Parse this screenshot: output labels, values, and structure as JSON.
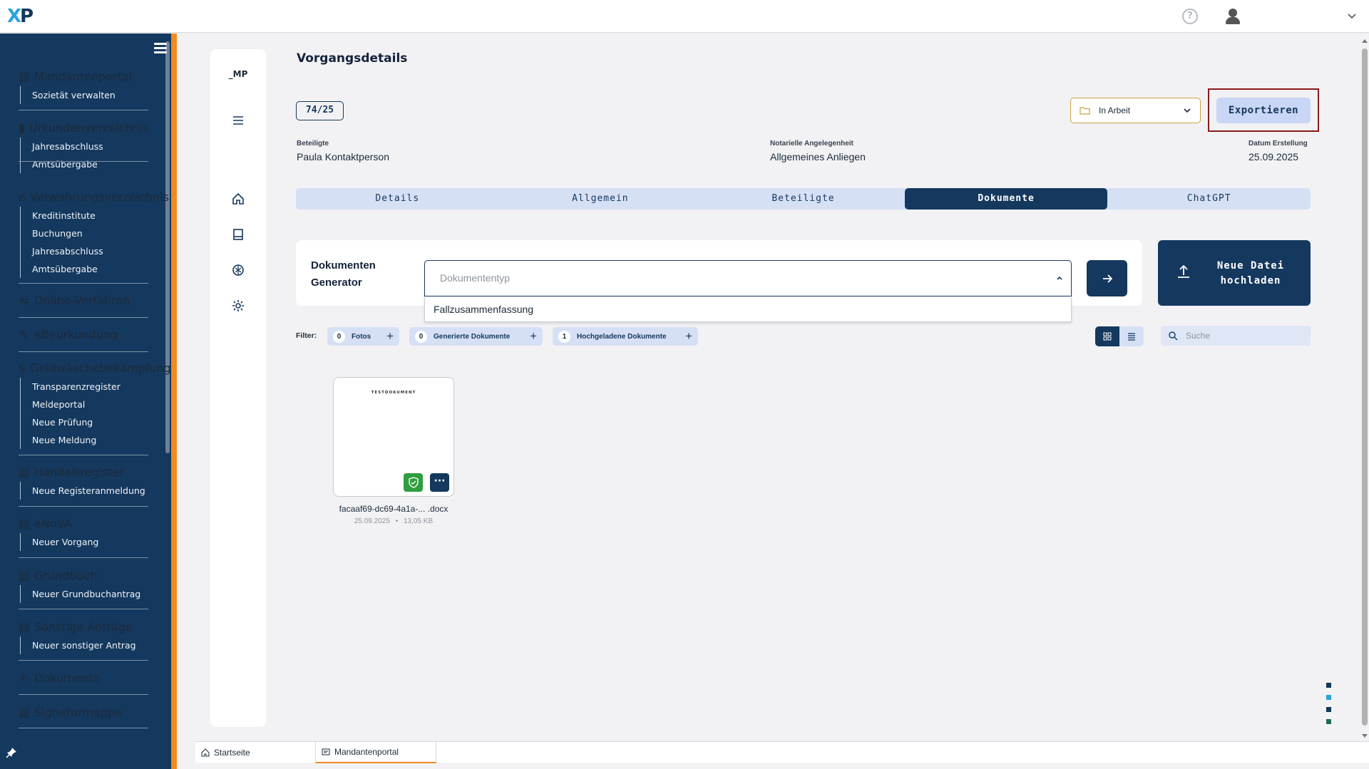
{
  "app": {
    "logo_text_x": "X",
    "logo_text_p": "P"
  },
  "topbar": {
    "help_glyph": "?"
  },
  "sidebar": {
    "groups": [
      {
        "title": "Mandantenportal",
        "icon": "portal-icon",
        "items": [
          "Sozietät verwalten"
        ]
      },
      {
        "title": "Urkundenverzeichnis",
        "icon": "ledger-icon",
        "items": [
          "Jahresabschluss",
          "Amtsübergabe"
        ]
      },
      {
        "title": "Verwahrungsverzeichnis",
        "icon": "bank-icon",
        "items": [
          "Kreditinstitute",
          "Buchungen",
          "Jahresabschluss",
          "Amtsübergabe"
        ]
      },
      {
        "title": "Online-Verfahren",
        "icon": "online-icon",
        "items": []
      },
      {
        "title": "eBeurkundung",
        "icon": "ecert-icon",
        "items": []
      },
      {
        "title": "Geldwäschebekämpfung",
        "icon": "money-search-icon",
        "items": [
          "Transparenzregister",
          "Meldeportal",
          "Neue Prüfung",
          "Neue Meldung"
        ]
      },
      {
        "title": "Handelsregister",
        "icon": "register-icon",
        "items": [
          "Neue Registeranmeldung"
        ]
      },
      {
        "title": "eNoVA",
        "icon": "enova-icon",
        "items": [
          "Neuer Vorgang"
        ]
      },
      {
        "title": "Grundbuch",
        "icon": "landbook-icon",
        "items": [
          "Neuer Grundbuchantrag"
        ]
      },
      {
        "title": "Sonstige Anträge",
        "icon": "forms-icon",
        "items": [
          "Neuer sonstiger Antrag"
        ]
      },
      {
        "title": "Dokumente",
        "icon": "documents-icon",
        "items": []
      },
      {
        "title": "Signaturmappe",
        "icon": "signature-icon",
        "items": []
      }
    ]
  },
  "rail": {
    "label": "_MP"
  },
  "main": {
    "title": "Vorgangsdetails",
    "case_number": "74/25",
    "status": "In Arbeit",
    "export_label": "Exportieren",
    "meta": {
      "beteiligte_label": "Beteiligte",
      "beteiligte_value": "Paula Kontaktperson",
      "angelegenheit_label": "Notarielle Angelegenheit",
      "angelegenheit_value": "Allgemeines Anliegen",
      "datum_label": "Datum Erstellung",
      "datum_value": "25.09.2025"
    },
    "tabs": [
      "Details",
      "Allgemein",
      "Beteiligte",
      "Dokumente",
      "ChatGPT"
    ],
    "active_tab": "Dokumente",
    "generator": {
      "label_line1": "Dokumenten",
      "label_line2": "Generator",
      "placeholder": "Dokumententyp",
      "dropdown_option": "Fallzusammenfassung"
    },
    "upload": {
      "line1": "Neue Datei",
      "line2": "hochladen"
    },
    "filter": {
      "label": "Filter:",
      "chips": [
        {
          "count": "0",
          "label": "Fotos"
        },
        {
          "count": "0",
          "label": "Generierte Dokumente"
        },
        {
          "count": "1",
          "label": "Hochgeladene Dokumente"
        }
      ],
      "plus": "+"
    },
    "search_placeholder": "Suche",
    "document": {
      "thumb_title": "TESTDOKUMENT",
      "name": "facaaf69-dc69-4a1a-... .docx",
      "date": "25.09.2025",
      "separator": "•",
      "size": "13,05 KB",
      "more_glyph": "···"
    }
  },
  "bottom_tabs": [
    "Startseite",
    "Mandantenportal"
  ],
  "colors": {
    "brand": "#14385e",
    "accent": "#f28b1c",
    "light": "#d6e0f5",
    "success": "#2e9e3e",
    "highlight_frame": "#8b1a1a"
  }
}
